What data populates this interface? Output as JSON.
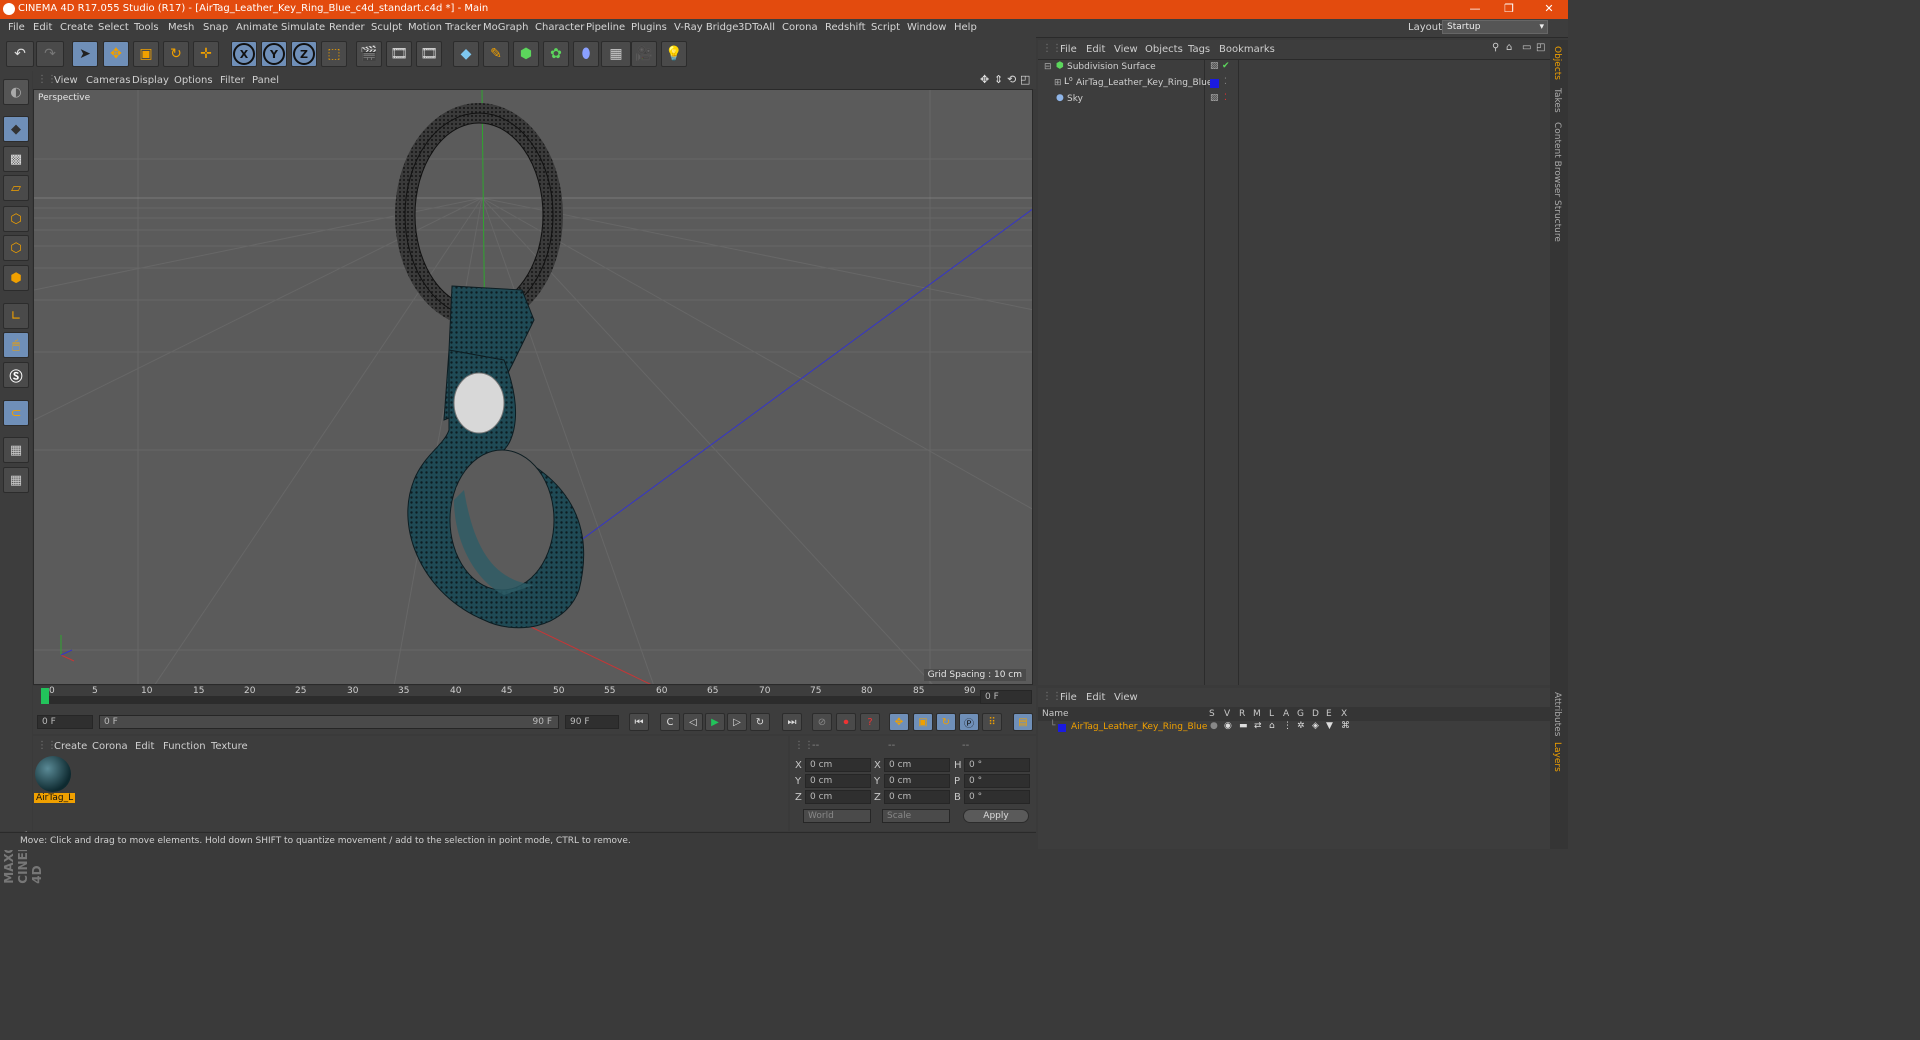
{
  "window": {
    "title": "CINEMA 4D R17.055 Studio (R17) - [AirTag_Leather_Key_Ring_Blue_c4d_standart.c4d *] - Main",
    "controls": {
      "minimize": "—",
      "restore": "❐",
      "close": "✕"
    }
  },
  "menu": [
    "File",
    "Edit",
    "Create",
    "Select",
    "Tools",
    "Mesh",
    "Snap",
    "Animate",
    "Simulate",
    "Render",
    "Sculpt",
    "Motion Tracker",
    "MoGraph",
    "Character",
    "Pipeline",
    "Plugins",
    "V-Ray Bridge",
    "3DToAll",
    "Corona",
    "Redshift",
    "Script",
    "Window",
    "Help"
  ],
  "layout": {
    "label": "Layout:",
    "value": "Startup"
  },
  "toolbar": {
    "axis_x": "X",
    "axis_y": "Y",
    "axis_z": "Z"
  },
  "viewport": {
    "menu": [
      "View",
      "Cameras",
      "Display",
      "Options",
      "Filter",
      "Panel"
    ],
    "camera": "Perspective",
    "grid_spacing": "Grid Spacing : 10 cm"
  },
  "timeline": {
    "ticks": [
      "0",
      "5",
      "10",
      "15",
      "20",
      "25",
      "30",
      "35",
      "40",
      "45",
      "50",
      "55",
      "60",
      "65",
      "70",
      "75",
      "80",
      "85",
      "90"
    ],
    "current_frame": "0 F",
    "start_field": "0 F",
    "range_start": "0 F",
    "range_end": "90 F",
    "end_field": "90 F"
  },
  "material_panel": {
    "menu": [
      "Create",
      "Corona",
      "Edit",
      "Function",
      "Texture"
    ],
    "material_name": "AirTag_L"
  },
  "coords": {
    "headers": [
      "--",
      "--",
      "--"
    ],
    "rows": [
      {
        "a": "X",
        "av": "0 cm",
        "b": "X",
        "bv": "0 cm",
        "c": "H",
        "cv": "0 °"
      },
      {
        "a": "Y",
        "av": "0 cm",
        "b": "Y",
        "bv": "0 cm",
        "c": "P",
        "cv": "0 °"
      },
      {
        "a": "Z",
        "av": "0 cm",
        "b": "Z",
        "bv": "0 cm",
        "c": "B",
        "cv": "0 °"
      }
    ],
    "world": "World",
    "scale": "Scale",
    "apply": "Apply"
  },
  "status": "Move: Click and drag to move elements. Hold down SHIFT to quantize movement / add to the selection in point mode, CTRL to remove.",
  "objects_panel": {
    "menu": [
      "File",
      "Edit",
      "View",
      "Objects",
      "Tags",
      "Bookmarks"
    ],
    "items": [
      "Subdivision Surface",
      "AirTag_Leather_Key_Ring_Blue",
      "Sky"
    ]
  },
  "layers_panel": {
    "menu": [
      "File",
      "Edit",
      "View"
    ],
    "columns": [
      "Name",
      "S",
      "V",
      "R",
      "M",
      "L",
      "A",
      "G",
      "D",
      "E",
      "X"
    ],
    "layer_name": "AirTag_Leather_Key_Ring_Blue"
  },
  "right_tabs": [
    "Objects",
    "Takes",
    "Content Browser",
    "Structure",
    "Attributes",
    "Layers"
  ],
  "brand": "MAXON CINEMA 4D",
  "colors": {
    "title_bar": "#e34b0e",
    "accent_orange": "#f0a000",
    "selection_blue": "#6f8fb8",
    "layer_blue": "#1a1ae0"
  }
}
